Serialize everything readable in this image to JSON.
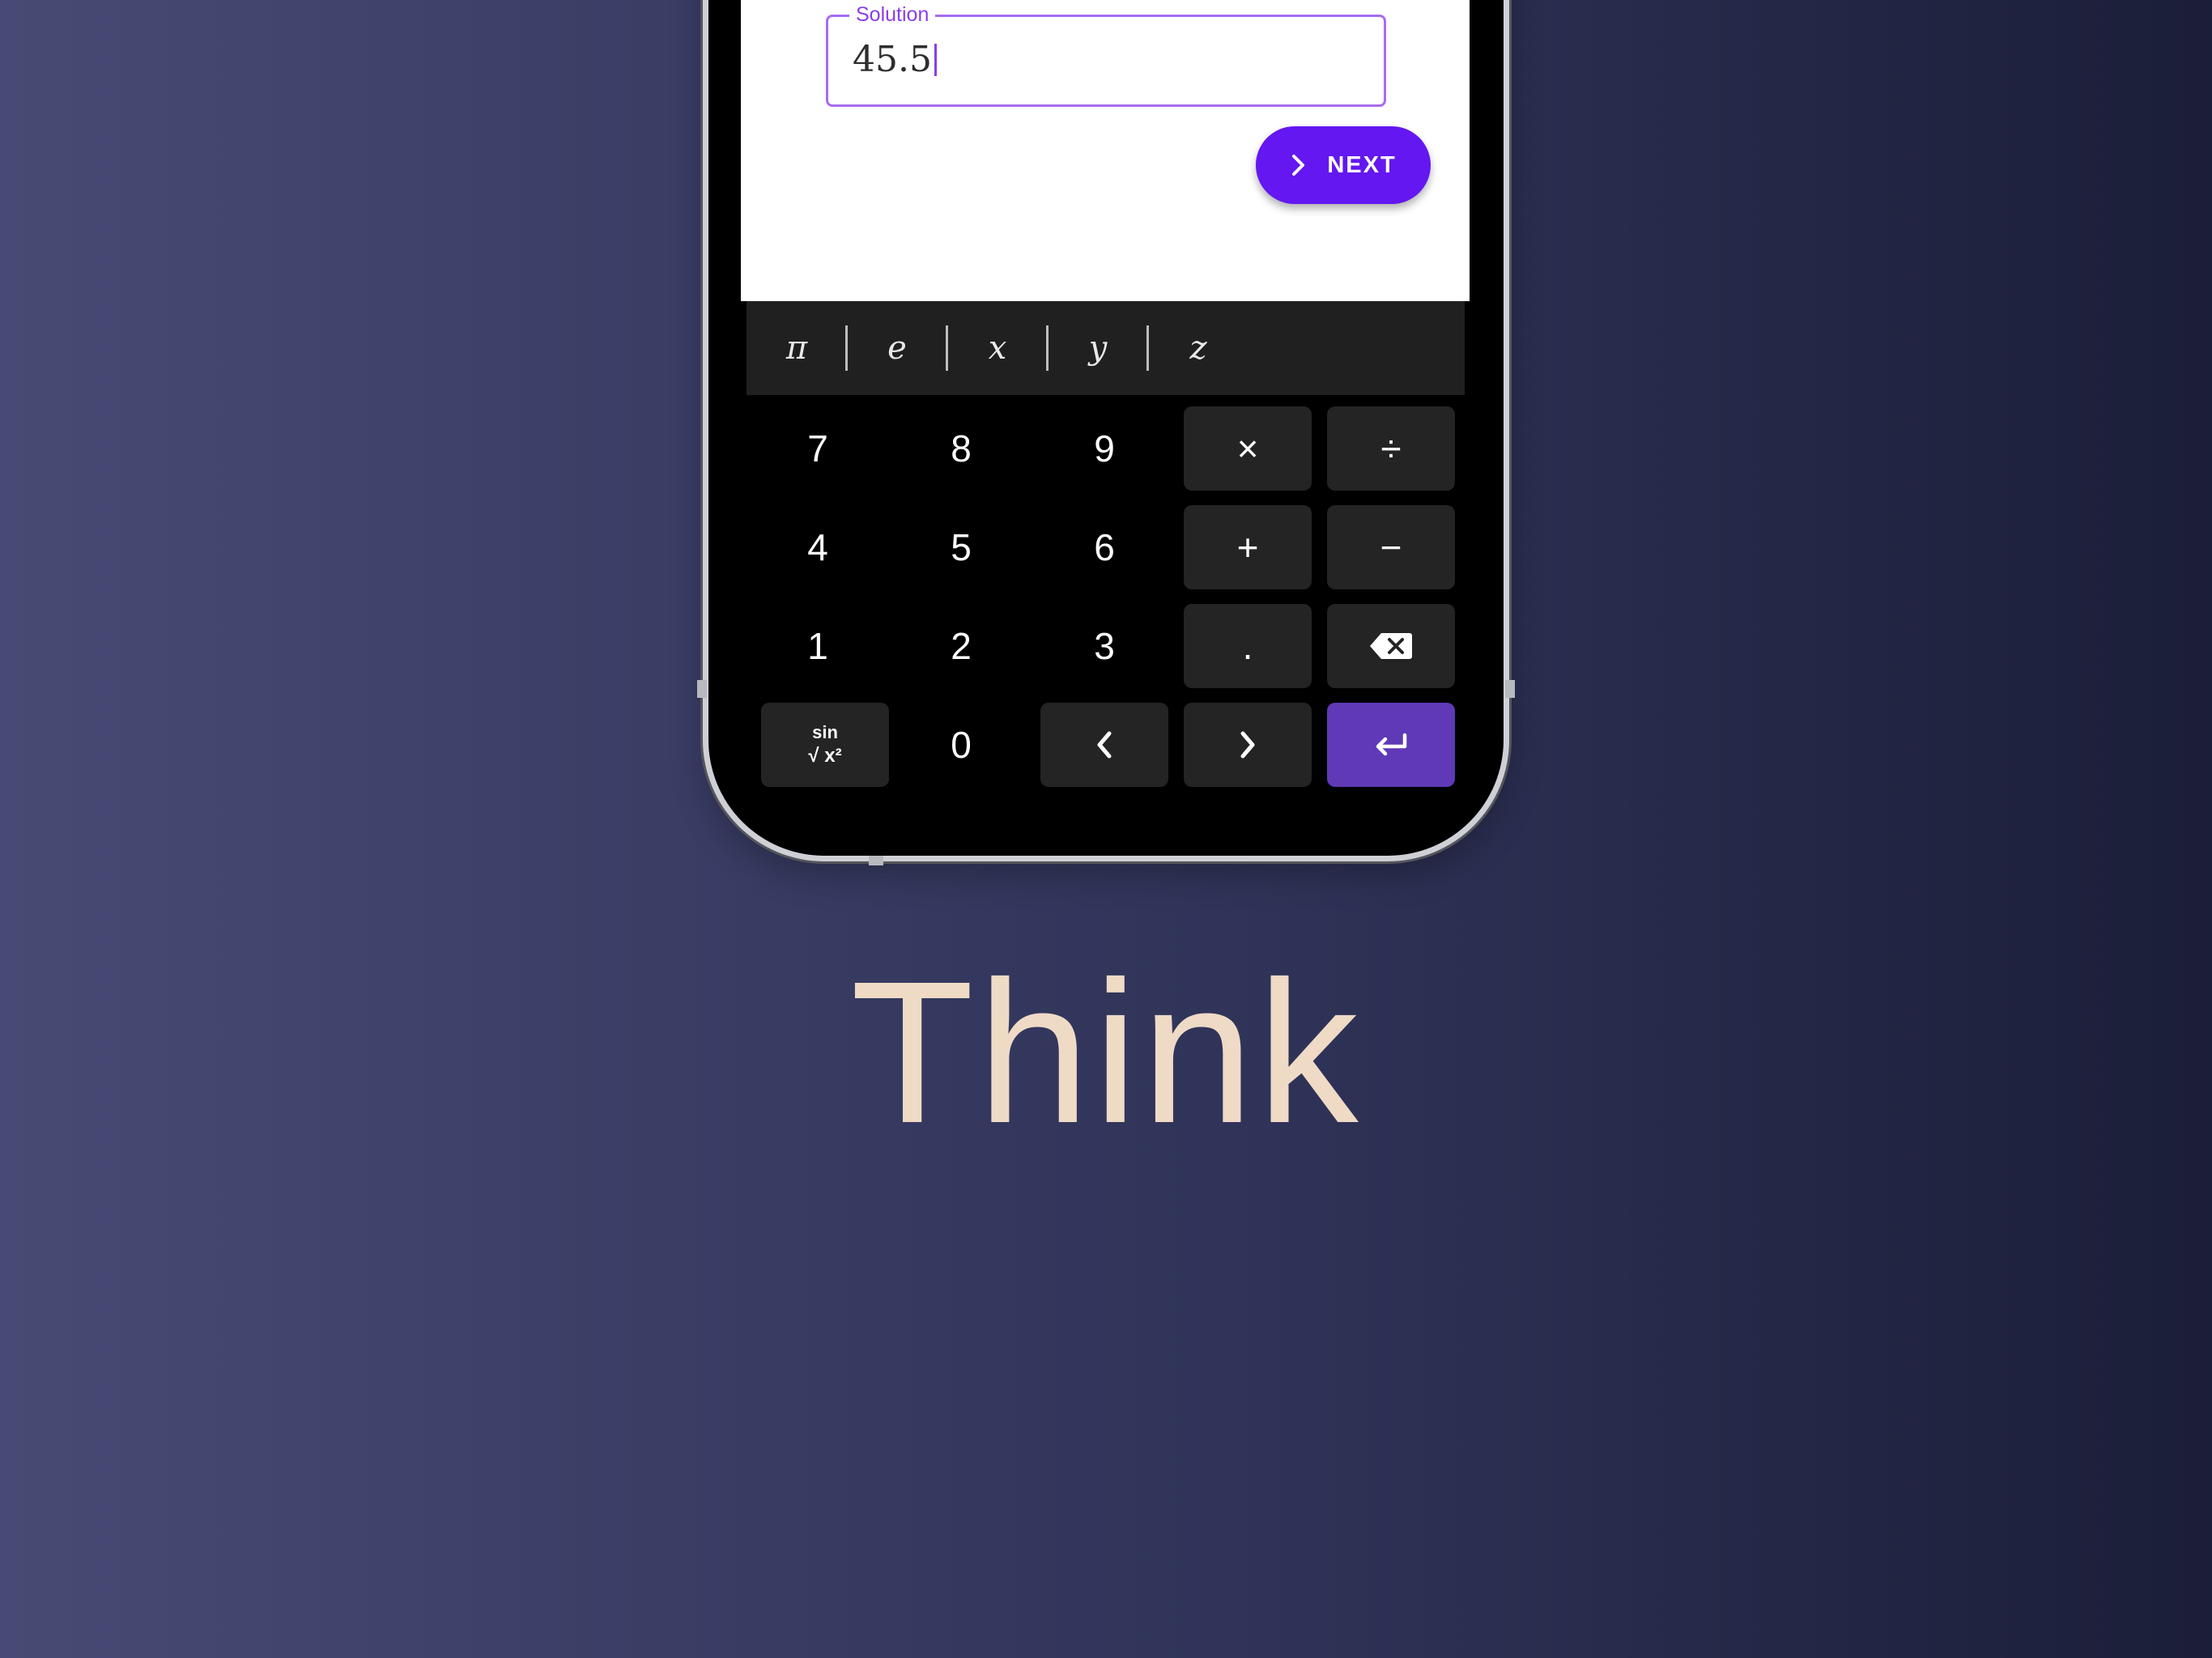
{
  "solution": {
    "label": "Solution",
    "value": "45.5"
  },
  "next_button": {
    "label": "NEXT",
    "icon": "chevron-right-icon"
  },
  "symbol_bar": [
    "π",
    "e",
    "x",
    "y",
    "z"
  ],
  "keys": {
    "seven": "7",
    "eight": "8",
    "nine": "9",
    "multiply": "×",
    "divide": "÷",
    "four": "4",
    "five": "5",
    "six": "6",
    "plus": "+",
    "minus": "−",
    "one": "1",
    "two": "2",
    "three": "3",
    "dot": ".",
    "functions_top": "sin",
    "functions_bottom": "√ x²",
    "zero": "0"
  },
  "headline": "Think",
  "colors": {
    "accent": "#6417f0",
    "enter_key": "#5f39b7",
    "field_border": "#a86cf0",
    "headline": "#efdac6"
  }
}
